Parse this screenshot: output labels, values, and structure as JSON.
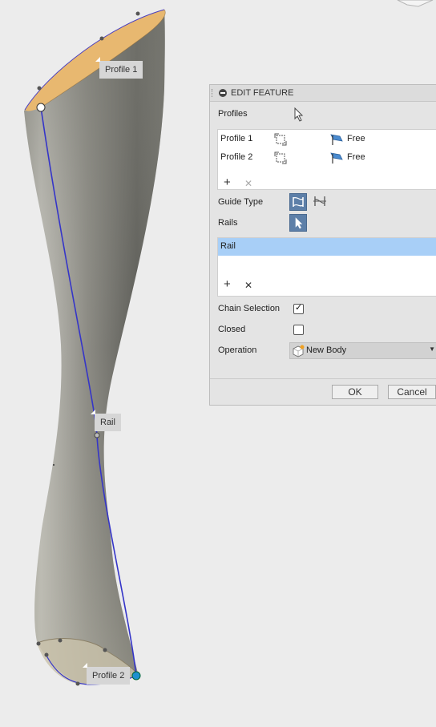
{
  "viewport": {
    "labels": {
      "profile1": "Profile 1",
      "rail": "Rail",
      "profile2": "Profile 2"
    },
    "colors": {
      "profile_face": "#e8b870",
      "rail_line": "#3535c8",
      "body_light": "#bdbdb6",
      "body_dark": "#5e5e58"
    }
  },
  "dialog": {
    "title": "EDIT FEATURE",
    "profiles_label": "Profiles",
    "profile_rows": [
      {
        "name": "Profile 1",
        "mode": "Free"
      },
      {
        "name": "Profile 2",
        "mode": "Free"
      }
    ],
    "guide_type_label": "Guide Type",
    "rails_label": "Rails",
    "rail_item": "Rail",
    "chain_selection_label": "Chain Selection",
    "chain_selection_checked": true,
    "closed_label": "Closed",
    "closed_checked": false,
    "operation_label": "Operation",
    "operation_value": "New Body",
    "ok_label": "OK",
    "cancel_label": "Cancel",
    "add_symbol": "+",
    "remove_symbol": "✕",
    "check_symbol": "✓",
    "caret_symbol": "▼"
  }
}
